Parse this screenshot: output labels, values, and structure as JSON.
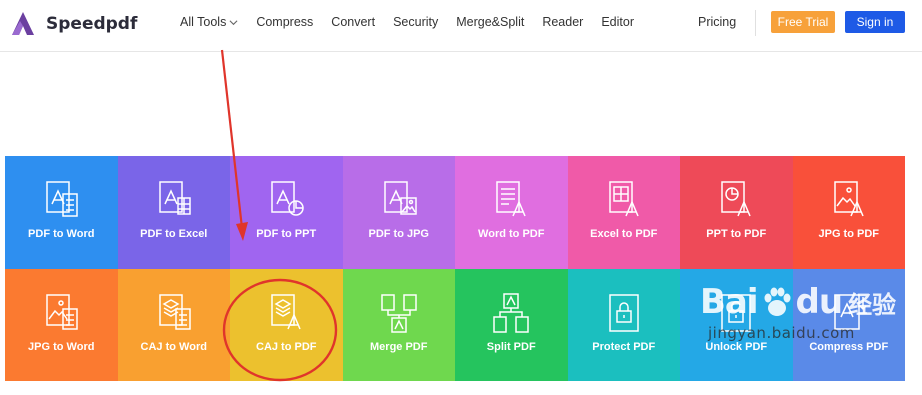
{
  "brand": {
    "name": "Speedpdf",
    "logo_color": "#6b3fa0"
  },
  "nav": {
    "items": [
      {
        "label": "All Tools",
        "has_dropdown": true
      },
      {
        "label": "Compress"
      },
      {
        "label": "Convert"
      },
      {
        "label": "Security"
      },
      {
        "label": "Merge&Split"
      },
      {
        "label": "Reader"
      },
      {
        "label": "Editor"
      }
    ],
    "pricing": "Pricing",
    "free_trial": "Free Trial",
    "sign_in": "Sign in",
    "free_trial_color": "#f7a13a",
    "sign_in_color": "#1e5ae6"
  },
  "tools": [
    {
      "label": "PDF to Word",
      "color": "#2e8ff0",
      "icon": "pdf-to-word-icon"
    },
    {
      "label": "PDF to Excel",
      "color": "#7a65e8",
      "icon": "pdf-to-excel-icon"
    },
    {
      "label": "PDF to PPT",
      "color": "#a065f0",
      "icon": "pdf-to-ppt-icon"
    },
    {
      "label": "PDF to JPG",
      "color": "#b86de8",
      "icon": "pdf-to-jpg-icon"
    },
    {
      "label": "Word to PDF",
      "color": "#e06ee0",
      "icon": "word-to-pdf-icon"
    },
    {
      "label": "Excel to PDF",
      "color": "#f05aa8",
      "icon": "excel-to-pdf-icon"
    },
    {
      "label": "PPT to PDF",
      "color": "#ee4a58",
      "icon": "ppt-to-pdf-icon"
    },
    {
      "label": "JPG to PDF",
      "color": "#f9503a",
      "icon": "jpg-to-pdf-icon"
    },
    {
      "label": "JPG to Word",
      "color": "#fb7a30",
      "icon": "jpg-to-word-icon"
    },
    {
      "label": "CAJ to Word",
      "color": "#f9a030",
      "icon": "caj-to-word-icon"
    },
    {
      "label": "CAJ to PDF",
      "color": "#ecc12e",
      "icon": "caj-to-pdf-icon"
    },
    {
      "label": "Merge PDF",
      "color": "#6fd84e",
      "icon": "merge-pdf-icon"
    },
    {
      "label": "Split PDF",
      "color": "#25c45e",
      "icon": "split-pdf-icon"
    },
    {
      "label": "Protect PDF",
      "color": "#1bbfbf",
      "icon": "protect-pdf-icon"
    },
    {
      "label": "Unlock PDF",
      "color": "#24a8e6",
      "icon": "unlock-pdf-icon"
    },
    {
      "label": "Compress PDF",
      "color": "#5a8ae8",
      "icon": "compress-pdf-icon"
    }
  ],
  "annotation": {
    "color": "#e0352b",
    "highlighted_tool": "CAJ to PDF"
  },
  "watermark": {
    "brand_left": "Bai",
    "brand_right": "du",
    "brand_cn": "经验",
    "url": "jingyan.baidu.com"
  }
}
